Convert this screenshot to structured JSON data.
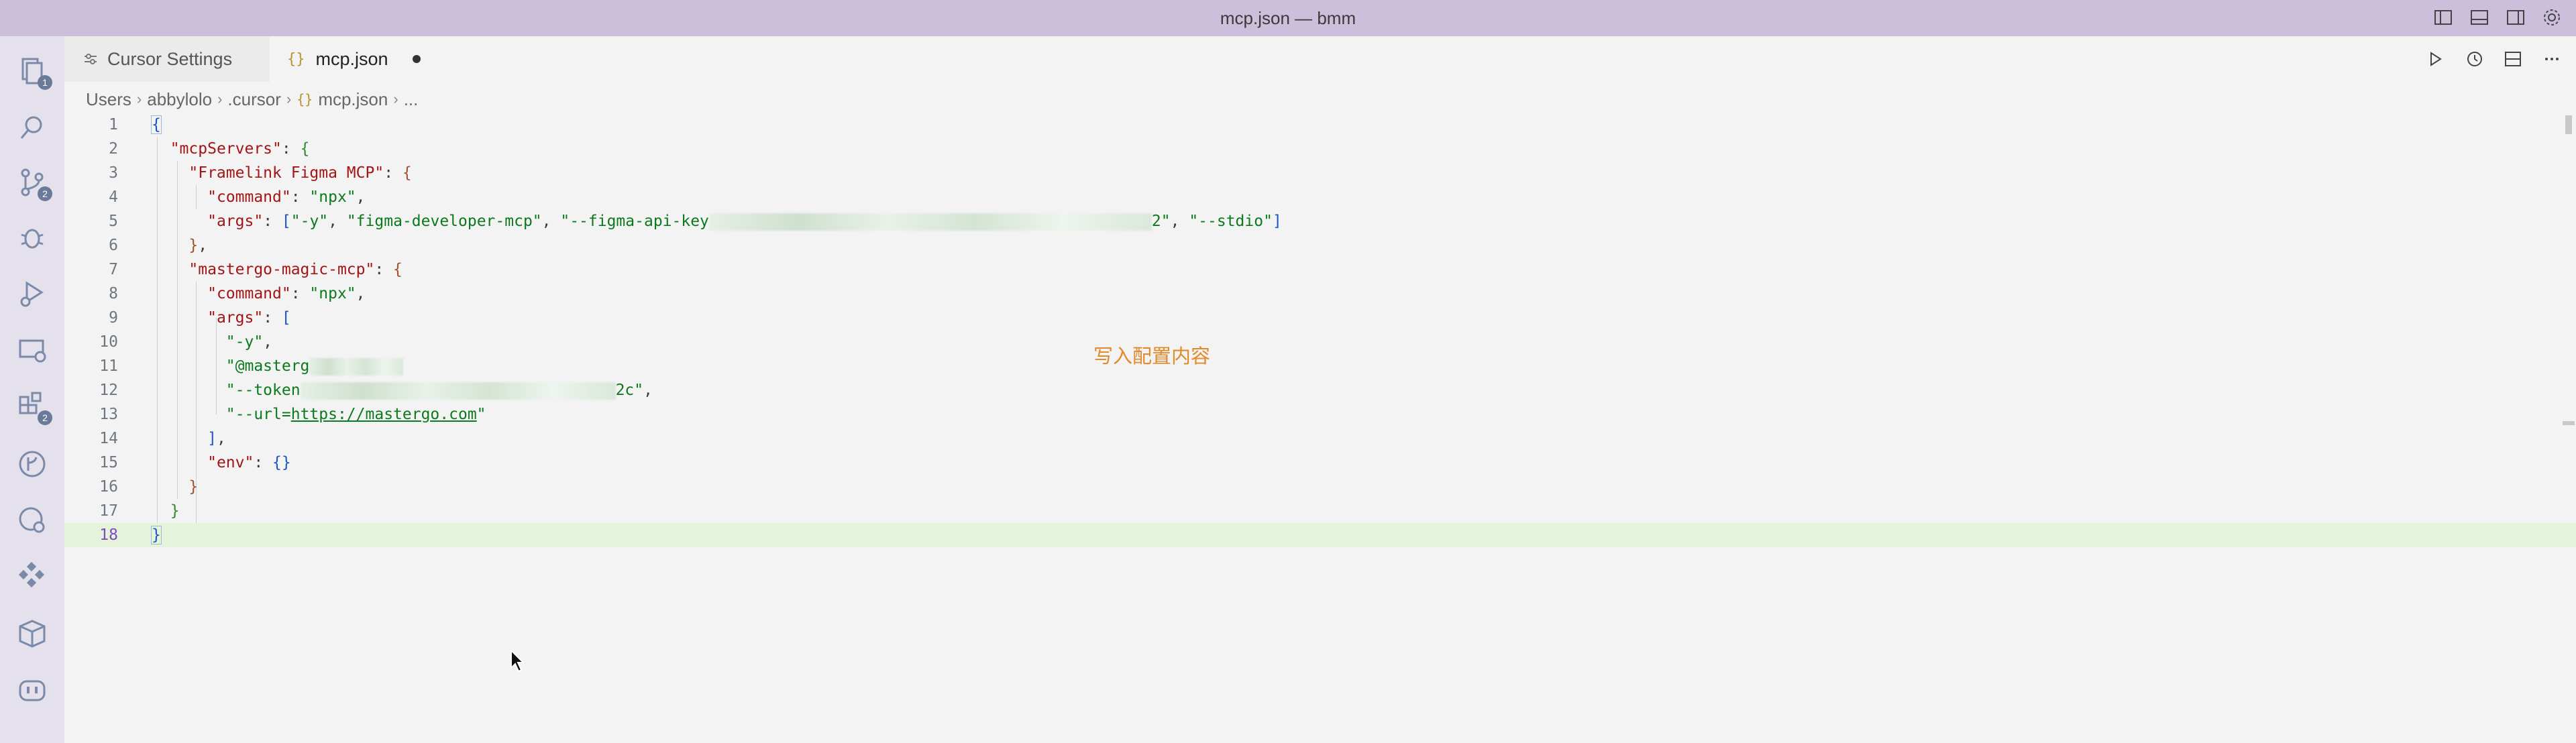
{
  "window": {
    "title": "mcp.json — bmm"
  },
  "activity_bar": {
    "items": [
      {
        "name": "explorer-icon",
        "badge": "1"
      },
      {
        "name": "search-icon",
        "badge": ""
      },
      {
        "name": "source-control-icon",
        "badge": "2"
      },
      {
        "name": "debug-icon",
        "badge": ""
      },
      {
        "name": "run-debug-icon",
        "badge": ""
      },
      {
        "name": "remote-explorer-icon",
        "badge": ""
      },
      {
        "name": "extensions-icon",
        "badge": "2"
      },
      {
        "name": "git-graph-icon",
        "badge": ""
      },
      {
        "name": "timeline-icon",
        "badge": ""
      },
      {
        "name": "figma-icon",
        "badge": ""
      },
      {
        "name": "package-icon",
        "badge": ""
      },
      {
        "name": "copilot-icon",
        "badge": ""
      }
    ]
  },
  "tabs": [
    {
      "label": "Cursor Settings",
      "active": false
    },
    {
      "label": "mcp.json",
      "active": true,
      "glyph": "{}"
    }
  ],
  "breadcrumb": {
    "parts": [
      "Users",
      "abbylolo",
      ".cursor",
      "mcp.json",
      "..."
    ],
    "glyph": "{}"
  },
  "editor": {
    "line_numbers": [
      "1",
      "2",
      "3",
      "4",
      "5",
      "6",
      "7",
      "8",
      "9",
      "10",
      "11",
      "12",
      "13",
      "14",
      "15",
      "16",
      "17",
      "18"
    ],
    "active_line": "18",
    "strings": {
      "mcpServers": "\"mcpServers\"",
      "framelink": "\"Framelink Figma MCP\"",
      "command": "\"command\"",
      "npx": "\"npx\"",
      "args": "\"args\"",
      "y": "\"-y\"",
      "figma_dev": "\"figma-developer-mcp\"",
      "figma_api_key_start": "\"--figma-api-key",
      "figma_api_key_end": "2\"",
      "stdio": "\"--stdio\"",
      "mastergo": "\"mastergo-magic-mcp\"",
      "mastergo_pkg_start": "\"@masterg",
      "token_start": "\"--token",
      "token_end": "2c\"",
      "url_prefix": "\"--url=",
      "url": "https://mastergo.com",
      "url_suffix": "\"",
      "env": "\"env\""
    }
  },
  "annotation": "写入配置内容"
}
